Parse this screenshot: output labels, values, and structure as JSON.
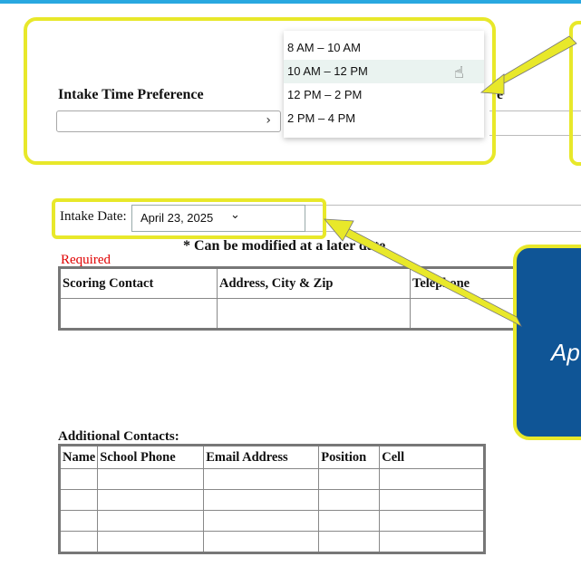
{
  "intake_time": {
    "label": "Intake Time Preference",
    "label_tail": "e",
    "select_value": "",
    "options": [
      "8 AM – 10 AM",
      "10 AM – 12 PM",
      "12 PM – 2 PM",
      "2 PM – 4 PM"
    ],
    "hovered_index": 1
  },
  "intake_date": {
    "label": "Intake Date:",
    "value": "April 23, 2025"
  },
  "note": "* Can be modified at a later date",
  "required_label": "Required",
  "scoring_table": {
    "headers": [
      "Scoring Contact",
      "Address, City & Zip",
      "Telephone"
    ]
  },
  "additional_contacts": {
    "label": "Additional Contacts:",
    "headers": [
      "Name",
      "School Phone",
      "Email Address",
      "Position",
      "Cell"
    ]
  },
  "callout_text": "Ap",
  "colors": {
    "highlight_border": "#e8e82a",
    "callout_fill": "#0f5596",
    "required_red": "#e00000",
    "top_bar": "#29a8e0"
  }
}
